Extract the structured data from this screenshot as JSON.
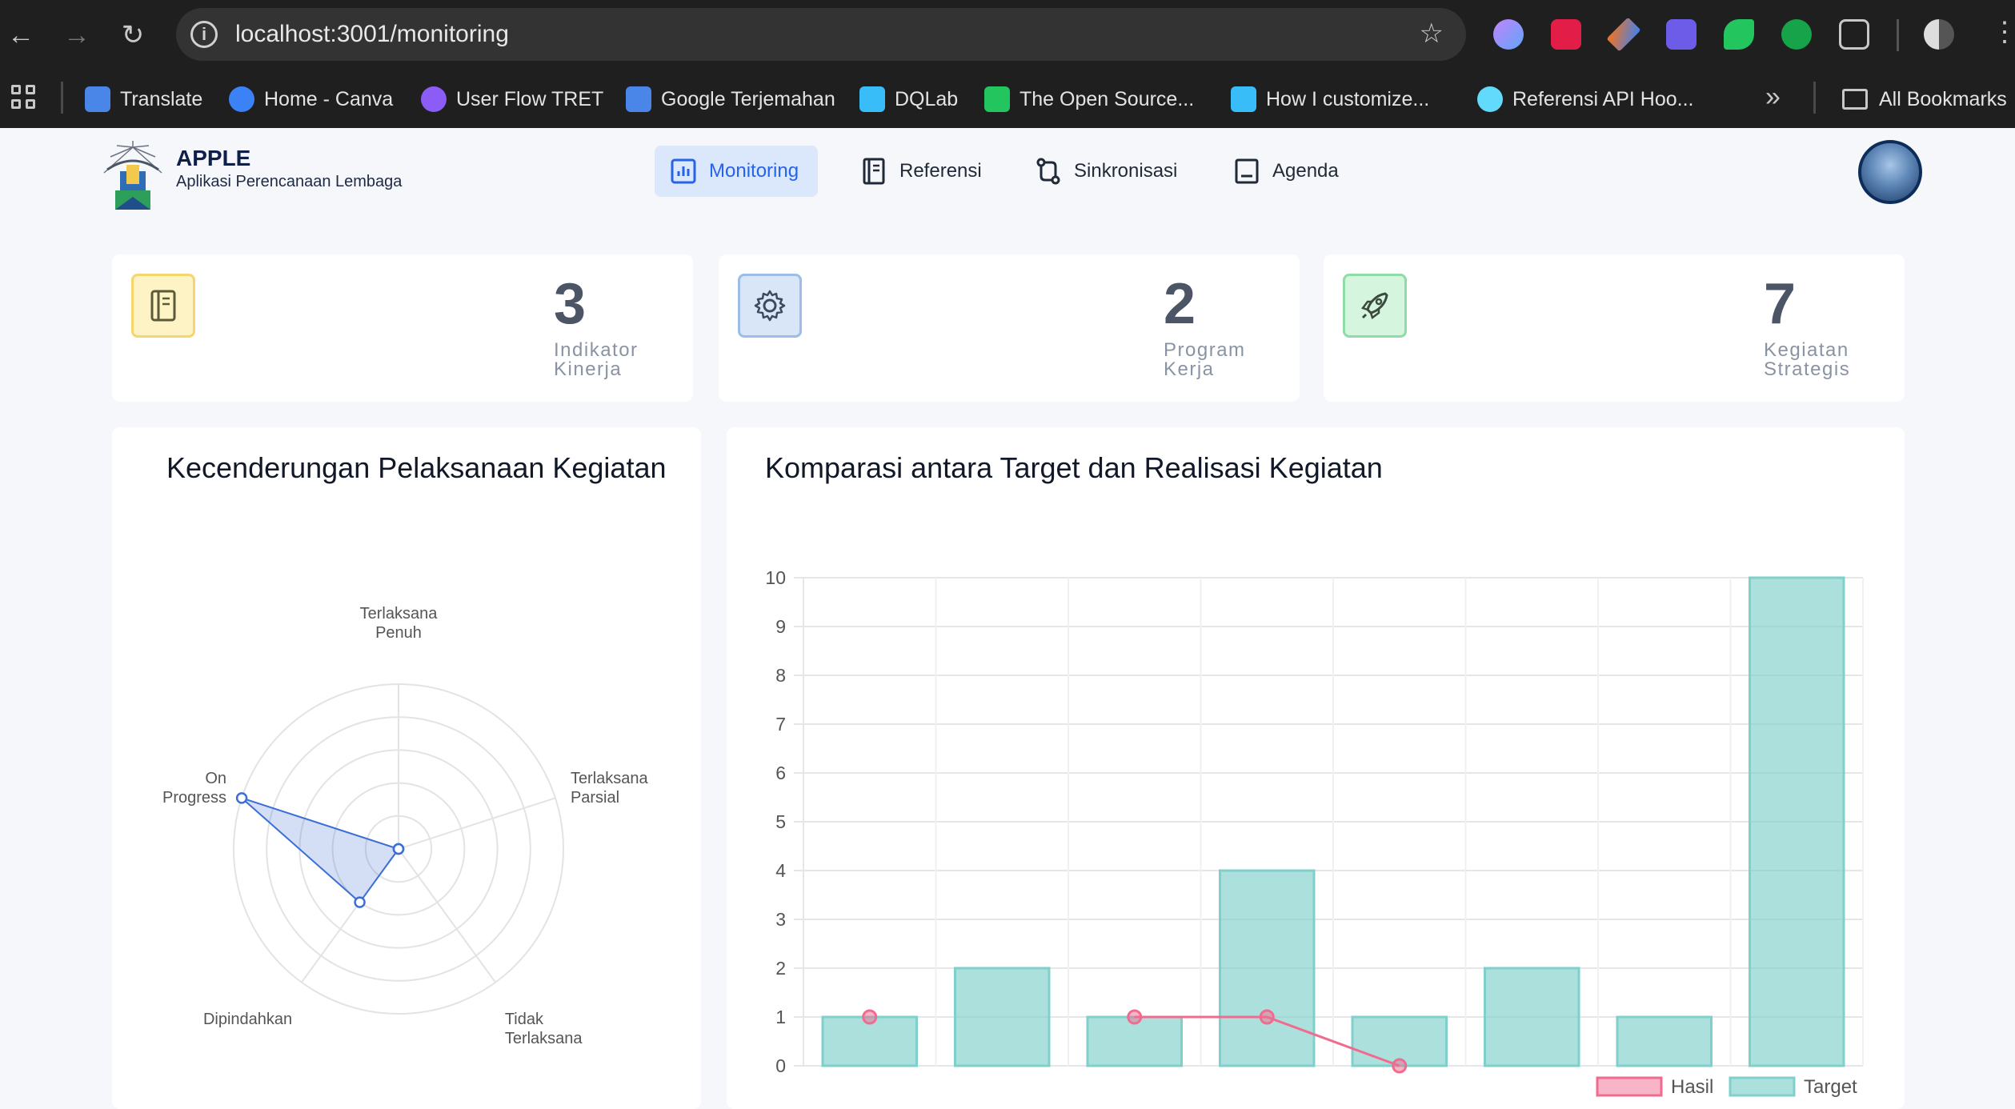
{
  "browser": {
    "url": "localhost:3001/monitoring",
    "bookmarks": [
      {
        "label": "Translate",
        "color": "#4a86e8"
      },
      {
        "label": "Home - Canva",
        "color": "#3b82f6"
      },
      {
        "label": "User Flow TRET",
        "color": "#8b5cf6"
      },
      {
        "label": "Google Terjemahan",
        "color": "#4a86e8"
      },
      {
        "label": "DQLab",
        "color": "#38bdf8"
      },
      {
        "label": "The Open Source...",
        "color": "#22c55e"
      },
      {
        "label": "How I customize...",
        "color": "#38bdf8"
      },
      {
        "label": "Referensi API Hoo...",
        "color": "#61dafb"
      }
    ],
    "all_bookmarks": "All Bookmarks"
  },
  "header": {
    "brand_title": "APPLE",
    "brand_subtitle": "Aplikasi Perencanaan Lembaga",
    "nav": [
      {
        "label": "Monitoring",
        "active": true,
        "icon": "chart-icon"
      },
      {
        "label": "Referensi",
        "active": false,
        "icon": "book-icon"
      },
      {
        "label": "Sinkronisasi",
        "active": false,
        "icon": "sync-icon"
      },
      {
        "label": "Agenda",
        "active": false,
        "icon": "agenda-icon"
      }
    ]
  },
  "stats": [
    {
      "value": "3",
      "label": "Indikator Kinerja",
      "icon": "notebook-icon",
      "bg": "#fdf3c4",
      "border": "#f5d66e"
    },
    {
      "value": "2",
      "label": "Program Kerja",
      "icon": "gear-icon",
      "bg": "#d9e6f8",
      "border": "#9dbde8"
    },
    {
      "value": "7",
      "label": "Kegiatan Strategis",
      "icon": "rocket-icon",
      "bg": "#d6f5de",
      "border": "#8fdca6"
    }
  ],
  "radar_panel": {
    "title": "Kecenderungan Pelaksanaan Kegiatan"
  },
  "bar_panel": {
    "title": "Komparasi antara Target dan Realisasi Kegiatan"
  },
  "chart_data": [
    {
      "type": "radar",
      "axes": [
        "Terlaksana Penuh",
        "Terlaksana Parsial",
        "Tidak Terlaksana",
        "Dipindahkan",
        "On Progress"
      ],
      "series": [
        {
          "values": [
            0,
            0,
            0,
            2,
            5
          ],
          "color": "#3b6fd6"
        }
      ],
      "rlim": [
        0,
        5
      ],
      "grid": true
    },
    {
      "type": "bar",
      "categories": [
        "",
        "",
        "",
        "",
        "",
        "",
        "",
        ""
      ],
      "series": [
        {
          "name": "Target",
          "type": "bar",
          "values": [
            1,
            2,
            1,
            4,
            1,
            2,
            1,
            10
          ],
          "color": "#7fcfcb"
        },
        {
          "name": "Hasil",
          "type": "line",
          "values": [
            1,
            null,
            1,
            1,
            0,
            null,
            null,
            null
          ],
          "color": "#f06c8f"
        }
      ],
      "ylim": [
        0,
        10
      ],
      "yticks": [
        0,
        1,
        2,
        3,
        4,
        5,
        6,
        7,
        8,
        9,
        10
      ],
      "grid": true,
      "legend": "bottom-right"
    }
  ]
}
